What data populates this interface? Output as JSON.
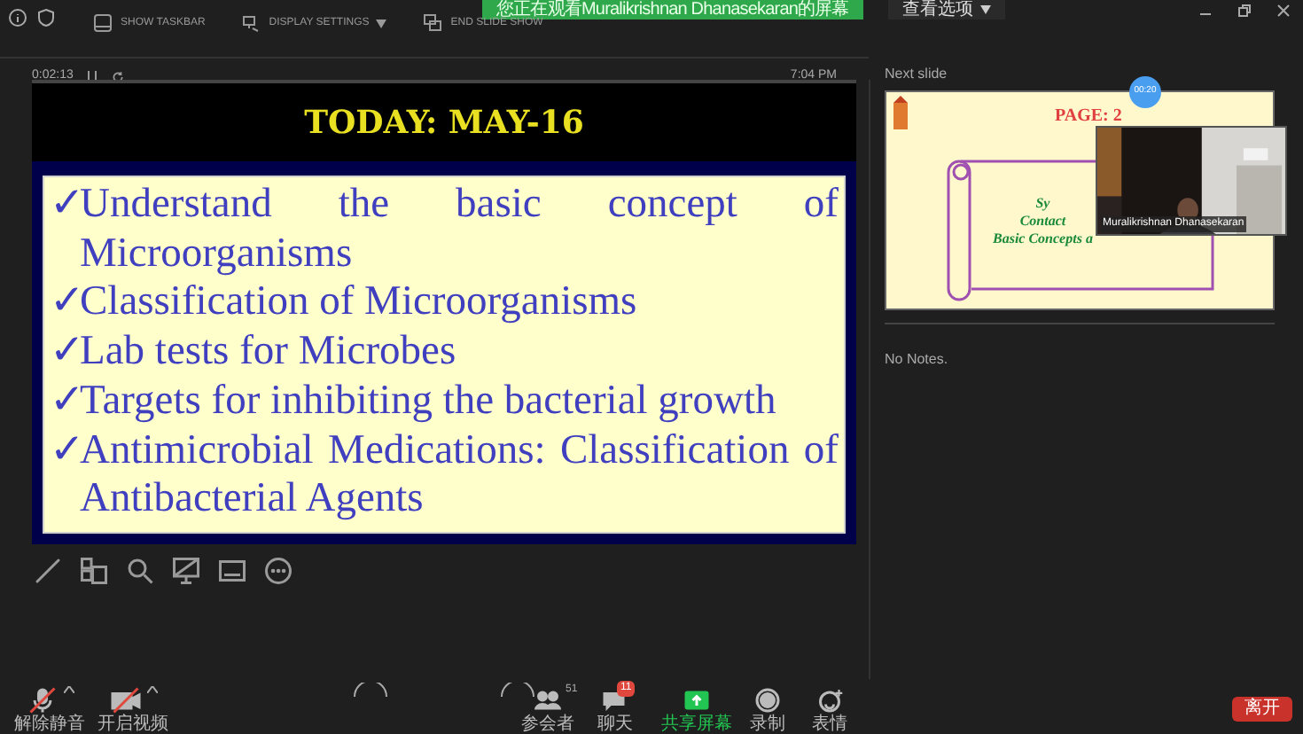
{
  "toolbar": {
    "items": [
      {
        "label": "SHOW TASKBAR",
        "kind": "taskbar"
      },
      {
        "label": "DISPLAY SETTINGS",
        "kind": "display",
        "dropdown": true
      },
      {
        "label": "END SLIDE SHOW",
        "kind": "end"
      }
    ]
  },
  "banner": {
    "text": "您正在观看Muralikrishnan Dhanasekaran的屏幕"
  },
  "view_options": {
    "label": "查看选项"
  },
  "timer": {
    "elapsed": "0:02:13",
    "clock": "7:04 PM"
  },
  "slide": {
    "title": "TODAY: MAY-16",
    "marker": "✓",
    "bullets": [
      "Understand the basic concept of Microorganisms",
      "Classification of Microorganisms",
      "Lab tests for Microbes",
      "Targets for inhibiting the bacterial growth",
      "Antimicrobial Medications: Classification of Antibacterial Agents"
    ]
  },
  "slide_tools": [
    {
      "kind": "pen"
    },
    {
      "kind": "slides"
    },
    {
      "kind": "zoom"
    },
    {
      "kind": "screen"
    },
    {
      "kind": "subtitles"
    },
    {
      "kind": "more"
    }
  ],
  "next_slide": {
    "label": "Next slide",
    "title": "PAGE: 2",
    "lines": [
      "Sy",
      "Contact",
      "Basic Concepts a"
    ],
    "timer": "00:20",
    "video": {
      "name": "Muralikrishnan Dhanasekaran"
    }
  },
  "notes": {
    "text": "No Notes."
  },
  "controls": [
    {
      "kind": "mic",
      "label": "解除静音",
      "muted": true,
      "caret": true
    },
    {
      "kind": "video",
      "label": "开启视频",
      "muted": true,
      "caret": true
    },
    {
      "kind": "participants",
      "label": "参会者",
      "count": "51"
    },
    {
      "kind": "chat",
      "label": "聊天",
      "badge": "11"
    },
    {
      "kind": "share",
      "label": "共享屏幕"
    },
    {
      "kind": "record",
      "label": "录制"
    },
    {
      "kind": "reactions",
      "label": "表情"
    }
  ],
  "leave": {
    "label": "离开"
  }
}
